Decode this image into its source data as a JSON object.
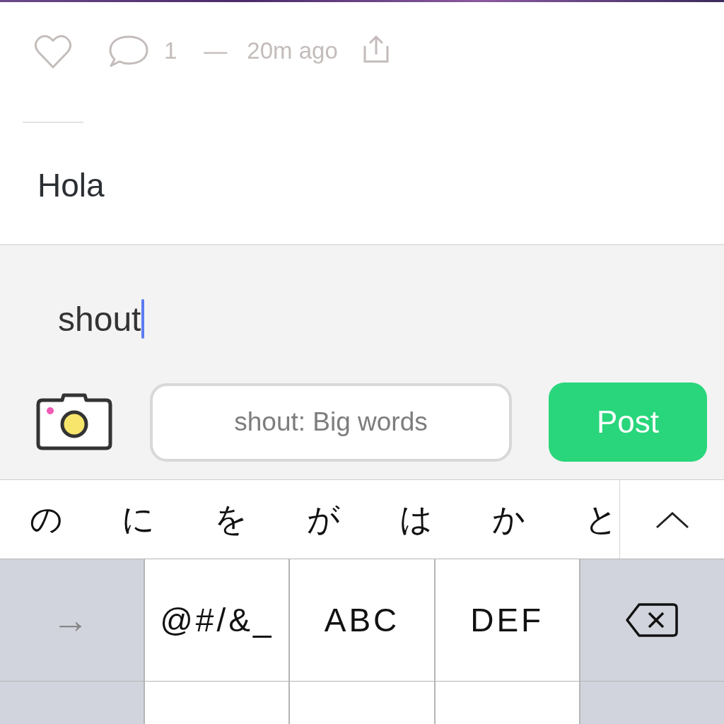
{
  "post": {
    "liked": false,
    "comment_count": "1",
    "separator": "—",
    "time": "20m ago",
    "reply_text": "Hola"
  },
  "composer": {
    "value": "shout",
    "style_button": "shout: Big words",
    "post_button": "Post"
  },
  "candidates": [
    "の",
    "に",
    "を",
    "が",
    "は",
    "か",
    "と"
  ],
  "keyboard": {
    "rows": [
      [
        {
          "kind": "function",
          "label": "→"
        },
        {
          "kind": "character",
          "label": "@#/&_"
        },
        {
          "kind": "character",
          "label": "ABC"
        },
        {
          "kind": "character",
          "label": "DEF"
        },
        {
          "kind": "delete"
        }
      ],
      [
        {
          "kind": "function"
        },
        {
          "kind": "character"
        },
        {
          "kind": "character"
        },
        {
          "kind": "character"
        },
        {
          "kind": "function"
        }
      ]
    ]
  }
}
